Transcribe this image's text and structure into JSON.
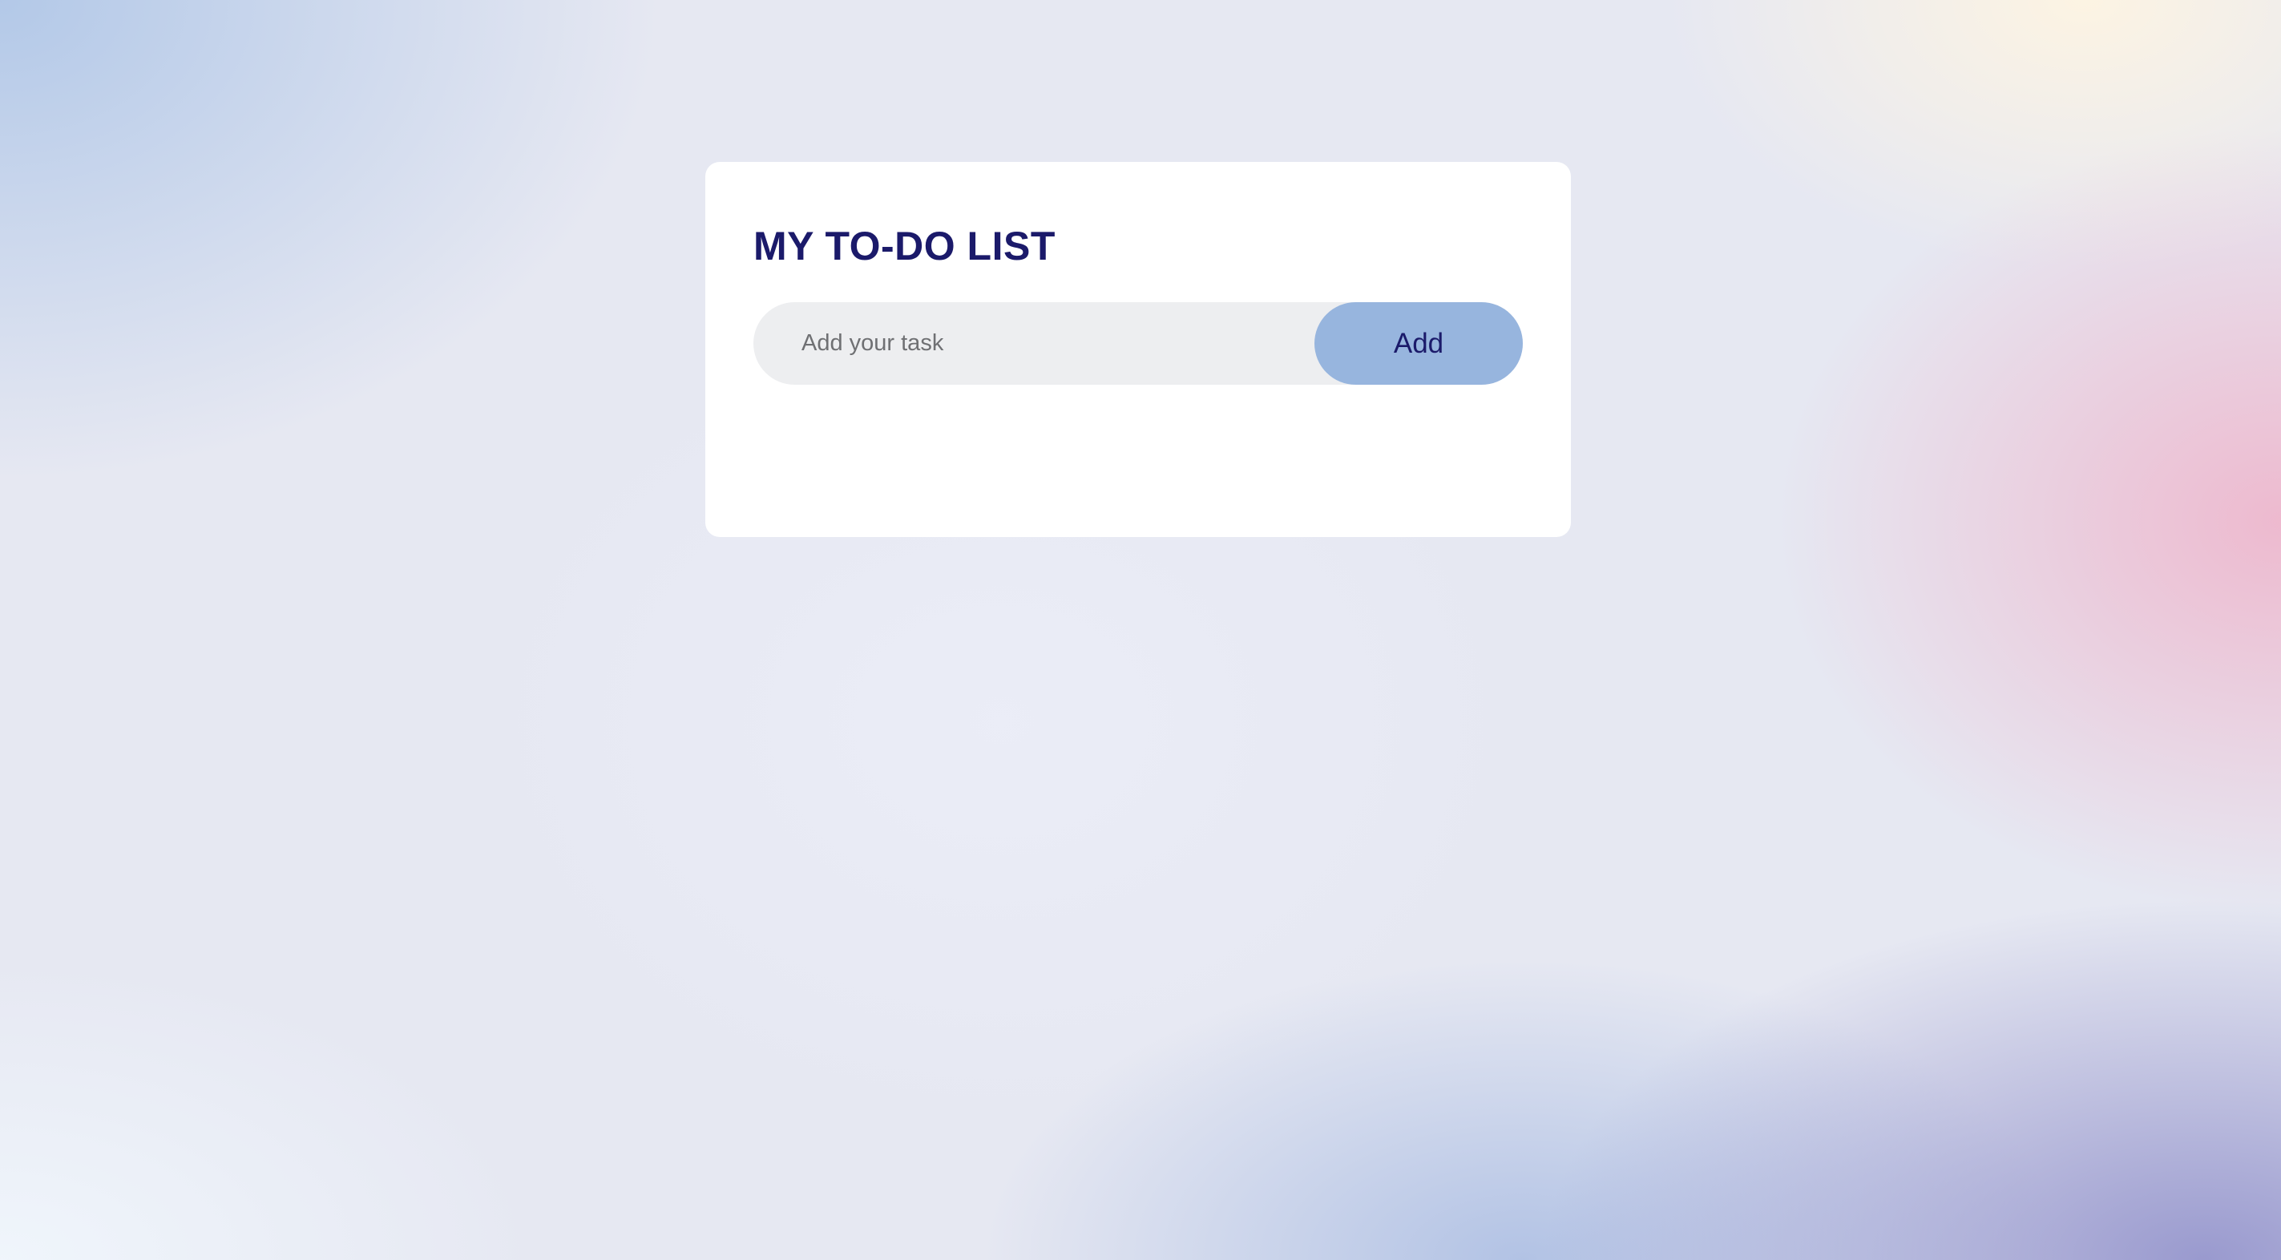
{
  "app": {
    "title": "MY TO-DO LIST"
  },
  "task_entry": {
    "placeholder": "Add your task",
    "value": "",
    "add_label": "Add"
  },
  "tasks": [],
  "colors": {
    "title": "#1b1a6a",
    "card": "#ffffff",
    "input_background": "#edeef0",
    "button_background": "#97b5de",
    "button_text": "#1b1a6a"
  }
}
